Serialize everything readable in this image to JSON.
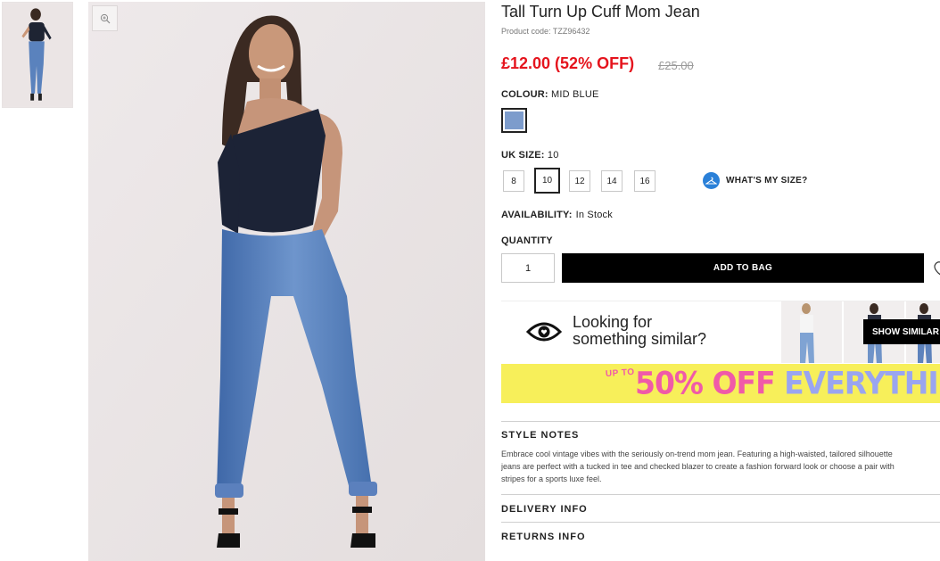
{
  "product": {
    "title": "Tall Turn Up Cuff Mom Jean",
    "code": "Product code: TZZ96432",
    "price": "£12.00 (52% OFF)",
    "was_price": "£25.00"
  },
  "colour": {
    "label": "COLOUR:",
    "value": "MID BLUE",
    "swatch_color": "#7d9ccc"
  },
  "size": {
    "label": "UK SIZE:",
    "value": "10",
    "options": [
      "8",
      "10",
      "12",
      "14",
      "16"
    ],
    "selected": "10",
    "whats_my_size": "WHAT'S MY SIZE?"
  },
  "availability": {
    "label": "AVAILABILITY:",
    "value": "In Stock"
  },
  "quantity": {
    "label": "QUANTITY",
    "value": "1"
  },
  "add_to_bag": "ADD TO BAG",
  "similar": {
    "line1": "Looking for",
    "line2": "something similar?",
    "button": "SHOW SIMILAR"
  },
  "banner": {
    "upto": "UP TO",
    "percent": "50% OFF",
    "everything": "EVERYTHING!"
  },
  "style_notes": {
    "title": "STYLE NOTES",
    "lines": [
      "Embrace cool vintage vibes with the seriously on-trend mom jean. Featuring a high-waisted, tailored silhouette",
      "jeans are perfect with a tucked in tee and checked blazer to create a fashion forward look or choose a pair with",
      "stripes for a sports luxe feel."
    ]
  },
  "delivery_info": "DELIVERY INFO",
  "returns_info": "RETURNS INFO",
  "icons": {
    "zoom": "zoom-in-icon",
    "hanger": "hanger-icon",
    "eye": "eye-heart-icon",
    "wishlist": "heart-icon"
  },
  "colors": {
    "price_red": "#e5141d",
    "hanger_blue": "#2a80d8",
    "banner_yellow": "#f7ef5a",
    "banner_pink": "#f05aa8",
    "banner_lilac": "#9aa5f0"
  }
}
